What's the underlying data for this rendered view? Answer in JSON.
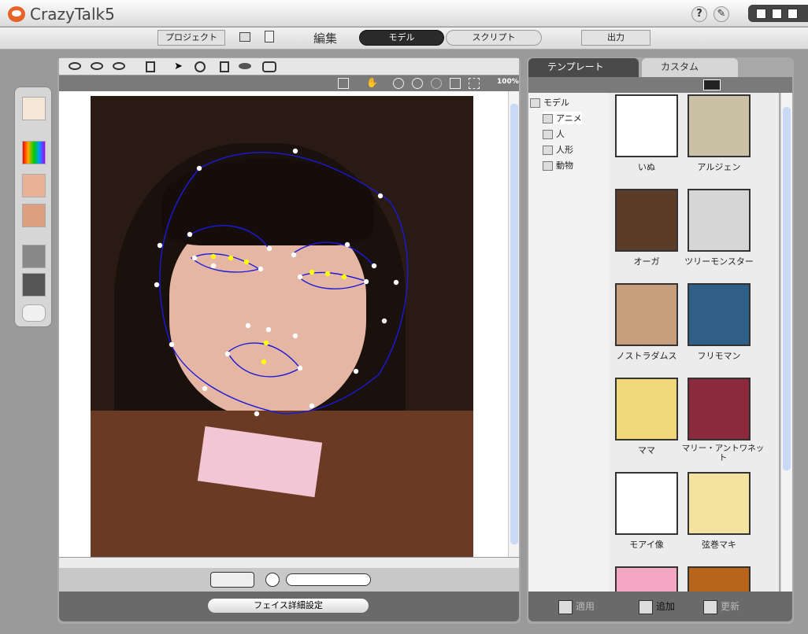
{
  "app": {
    "title": "CrazyTalk5",
    "title_version": "5"
  },
  "menu": {
    "project": "プロジェクト",
    "edit": "編集",
    "model_tab": "モデル",
    "script_tab": "スクリプト",
    "output": "出力"
  },
  "view": {
    "zoom": "100%"
  },
  "buttons": {
    "face_detail": "フェイス詳細設定",
    "apply": "適用",
    "add": "追加",
    "update": "更新"
  },
  "right_tabs": {
    "template": "テンプレート",
    "custom": "カスタム"
  },
  "tree": {
    "root": "モデル",
    "items": [
      "アニメ",
      "人",
      "人形",
      "動物"
    ]
  },
  "gallery": [
    "いぬ",
    "アルジェン",
    "オーガ",
    "ツリーモンスター",
    "ノストラダムス",
    "フリモマン",
    "ママ",
    "マリー・アントワネット",
    "モアイ像",
    "弦巻マキ"
  ],
  "colors": {
    "landmark_line": "#1a1ad8",
    "landmark_active": "#ffff00",
    "accent": "#e8632a"
  }
}
